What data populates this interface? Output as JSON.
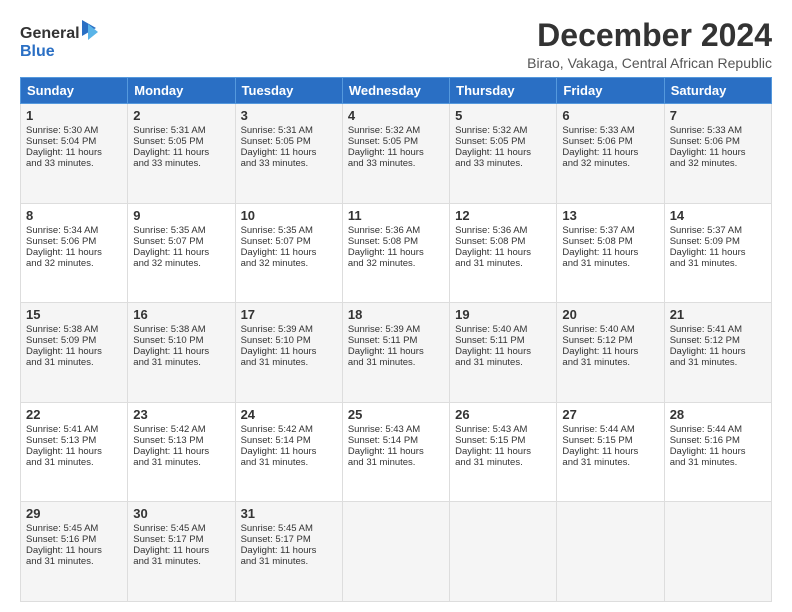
{
  "logo": {
    "line1": "General",
    "line2": "Blue"
  },
  "title": {
    "month": "December 2024",
    "location": "Birao, Vakaga, Central African Republic"
  },
  "headers": [
    "Sunday",
    "Monday",
    "Tuesday",
    "Wednesday",
    "Thursday",
    "Friday",
    "Saturday"
  ],
  "weeks": [
    [
      {
        "day": "1",
        "info": "Sunrise: 5:30 AM\nSunset: 5:04 PM\nDaylight: 11 hours\nand 33 minutes."
      },
      {
        "day": "2",
        "info": "Sunrise: 5:31 AM\nSunset: 5:05 PM\nDaylight: 11 hours\nand 33 minutes."
      },
      {
        "day": "3",
        "info": "Sunrise: 5:31 AM\nSunset: 5:05 PM\nDaylight: 11 hours\nand 33 minutes."
      },
      {
        "day": "4",
        "info": "Sunrise: 5:32 AM\nSunset: 5:05 PM\nDaylight: 11 hours\nand 33 minutes."
      },
      {
        "day": "5",
        "info": "Sunrise: 5:32 AM\nSunset: 5:05 PM\nDaylight: 11 hours\nand 33 minutes."
      },
      {
        "day": "6",
        "info": "Sunrise: 5:33 AM\nSunset: 5:06 PM\nDaylight: 11 hours\nand 32 minutes."
      },
      {
        "day": "7",
        "info": "Sunrise: 5:33 AM\nSunset: 5:06 PM\nDaylight: 11 hours\nand 32 minutes."
      }
    ],
    [
      {
        "day": "8",
        "info": "Sunrise: 5:34 AM\nSunset: 5:06 PM\nDaylight: 11 hours\nand 32 minutes."
      },
      {
        "day": "9",
        "info": "Sunrise: 5:35 AM\nSunset: 5:07 PM\nDaylight: 11 hours\nand 32 minutes."
      },
      {
        "day": "10",
        "info": "Sunrise: 5:35 AM\nSunset: 5:07 PM\nDaylight: 11 hours\nand 32 minutes."
      },
      {
        "day": "11",
        "info": "Sunrise: 5:36 AM\nSunset: 5:08 PM\nDaylight: 11 hours\nand 32 minutes."
      },
      {
        "day": "12",
        "info": "Sunrise: 5:36 AM\nSunset: 5:08 PM\nDaylight: 11 hours\nand 31 minutes."
      },
      {
        "day": "13",
        "info": "Sunrise: 5:37 AM\nSunset: 5:08 PM\nDaylight: 11 hours\nand 31 minutes."
      },
      {
        "day": "14",
        "info": "Sunrise: 5:37 AM\nSunset: 5:09 PM\nDaylight: 11 hours\nand 31 minutes."
      }
    ],
    [
      {
        "day": "15",
        "info": "Sunrise: 5:38 AM\nSunset: 5:09 PM\nDaylight: 11 hours\nand 31 minutes."
      },
      {
        "day": "16",
        "info": "Sunrise: 5:38 AM\nSunset: 5:10 PM\nDaylight: 11 hours\nand 31 minutes."
      },
      {
        "day": "17",
        "info": "Sunrise: 5:39 AM\nSunset: 5:10 PM\nDaylight: 11 hours\nand 31 minutes."
      },
      {
        "day": "18",
        "info": "Sunrise: 5:39 AM\nSunset: 5:11 PM\nDaylight: 11 hours\nand 31 minutes."
      },
      {
        "day": "19",
        "info": "Sunrise: 5:40 AM\nSunset: 5:11 PM\nDaylight: 11 hours\nand 31 minutes."
      },
      {
        "day": "20",
        "info": "Sunrise: 5:40 AM\nSunset: 5:12 PM\nDaylight: 11 hours\nand 31 minutes."
      },
      {
        "day": "21",
        "info": "Sunrise: 5:41 AM\nSunset: 5:12 PM\nDaylight: 11 hours\nand 31 minutes."
      }
    ],
    [
      {
        "day": "22",
        "info": "Sunrise: 5:41 AM\nSunset: 5:13 PM\nDaylight: 11 hours\nand 31 minutes."
      },
      {
        "day": "23",
        "info": "Sunrise: 5:42 AM\nSunset: 5:13 PM\nDaylight: 11 hours\nand 31 minutes."
      },
      {
        "day": "24",
        "info": "Sunrise: 5:42 AM\nSunset: 5:14 PM\nDaylight: 11 hours\nand 31 minutes."
      },
      {
        "day": "25",
        "info": "Sunrise: 5:43 AM\nSunset: 5:14 PM\nDaylight: 11 hours\nand 31 minutes."
      },
      {
        "day": "26",
        "info": "Sunrise: 5:43 AM\nSunset: 5:15 PM\nDaylight: 11 hours\nand 31 minutes."
      },
      {
        "day": "27",
        "info": "Sunrise: 5:44 AM\nSunset: 5:15 PM\nDaylight: 11 hours\nand 31 minutes."
      },
      {
        "day": "28",
        "info": "Sunrise: 5:44 AM\nSunset: 5:16 PM\nDaylight: 11 hours\nand 31 minutes."
      }
    ],
    [
      {
        "day": "29",
        "info": "Sunrise: 5:45 AM\nSunset: 5:16 PM\nDaylight: 11 hours\nand 31 minutes."
      },
      {
        "day": "30",
        "info": "Sunrise: 5:45 AM\nSunset: 5:17 PM\nDaylight: 11 hours\nand 31 minutes."
      },
      {
        "day": "31",
        "info": "Sunrise: 5:45 AM\nSunset: 5:17 PM\nDaylight: 11 hours\nand 31 minutes."
      },
      {
        "day": "",
        "info": ""
      },
      {
        "day": "",
        "info": ""
      },
      {
        "day": "",
        "info": ""
      },
      {
        "day": "",
        "info": ""
      }
    ]
  ]
}
